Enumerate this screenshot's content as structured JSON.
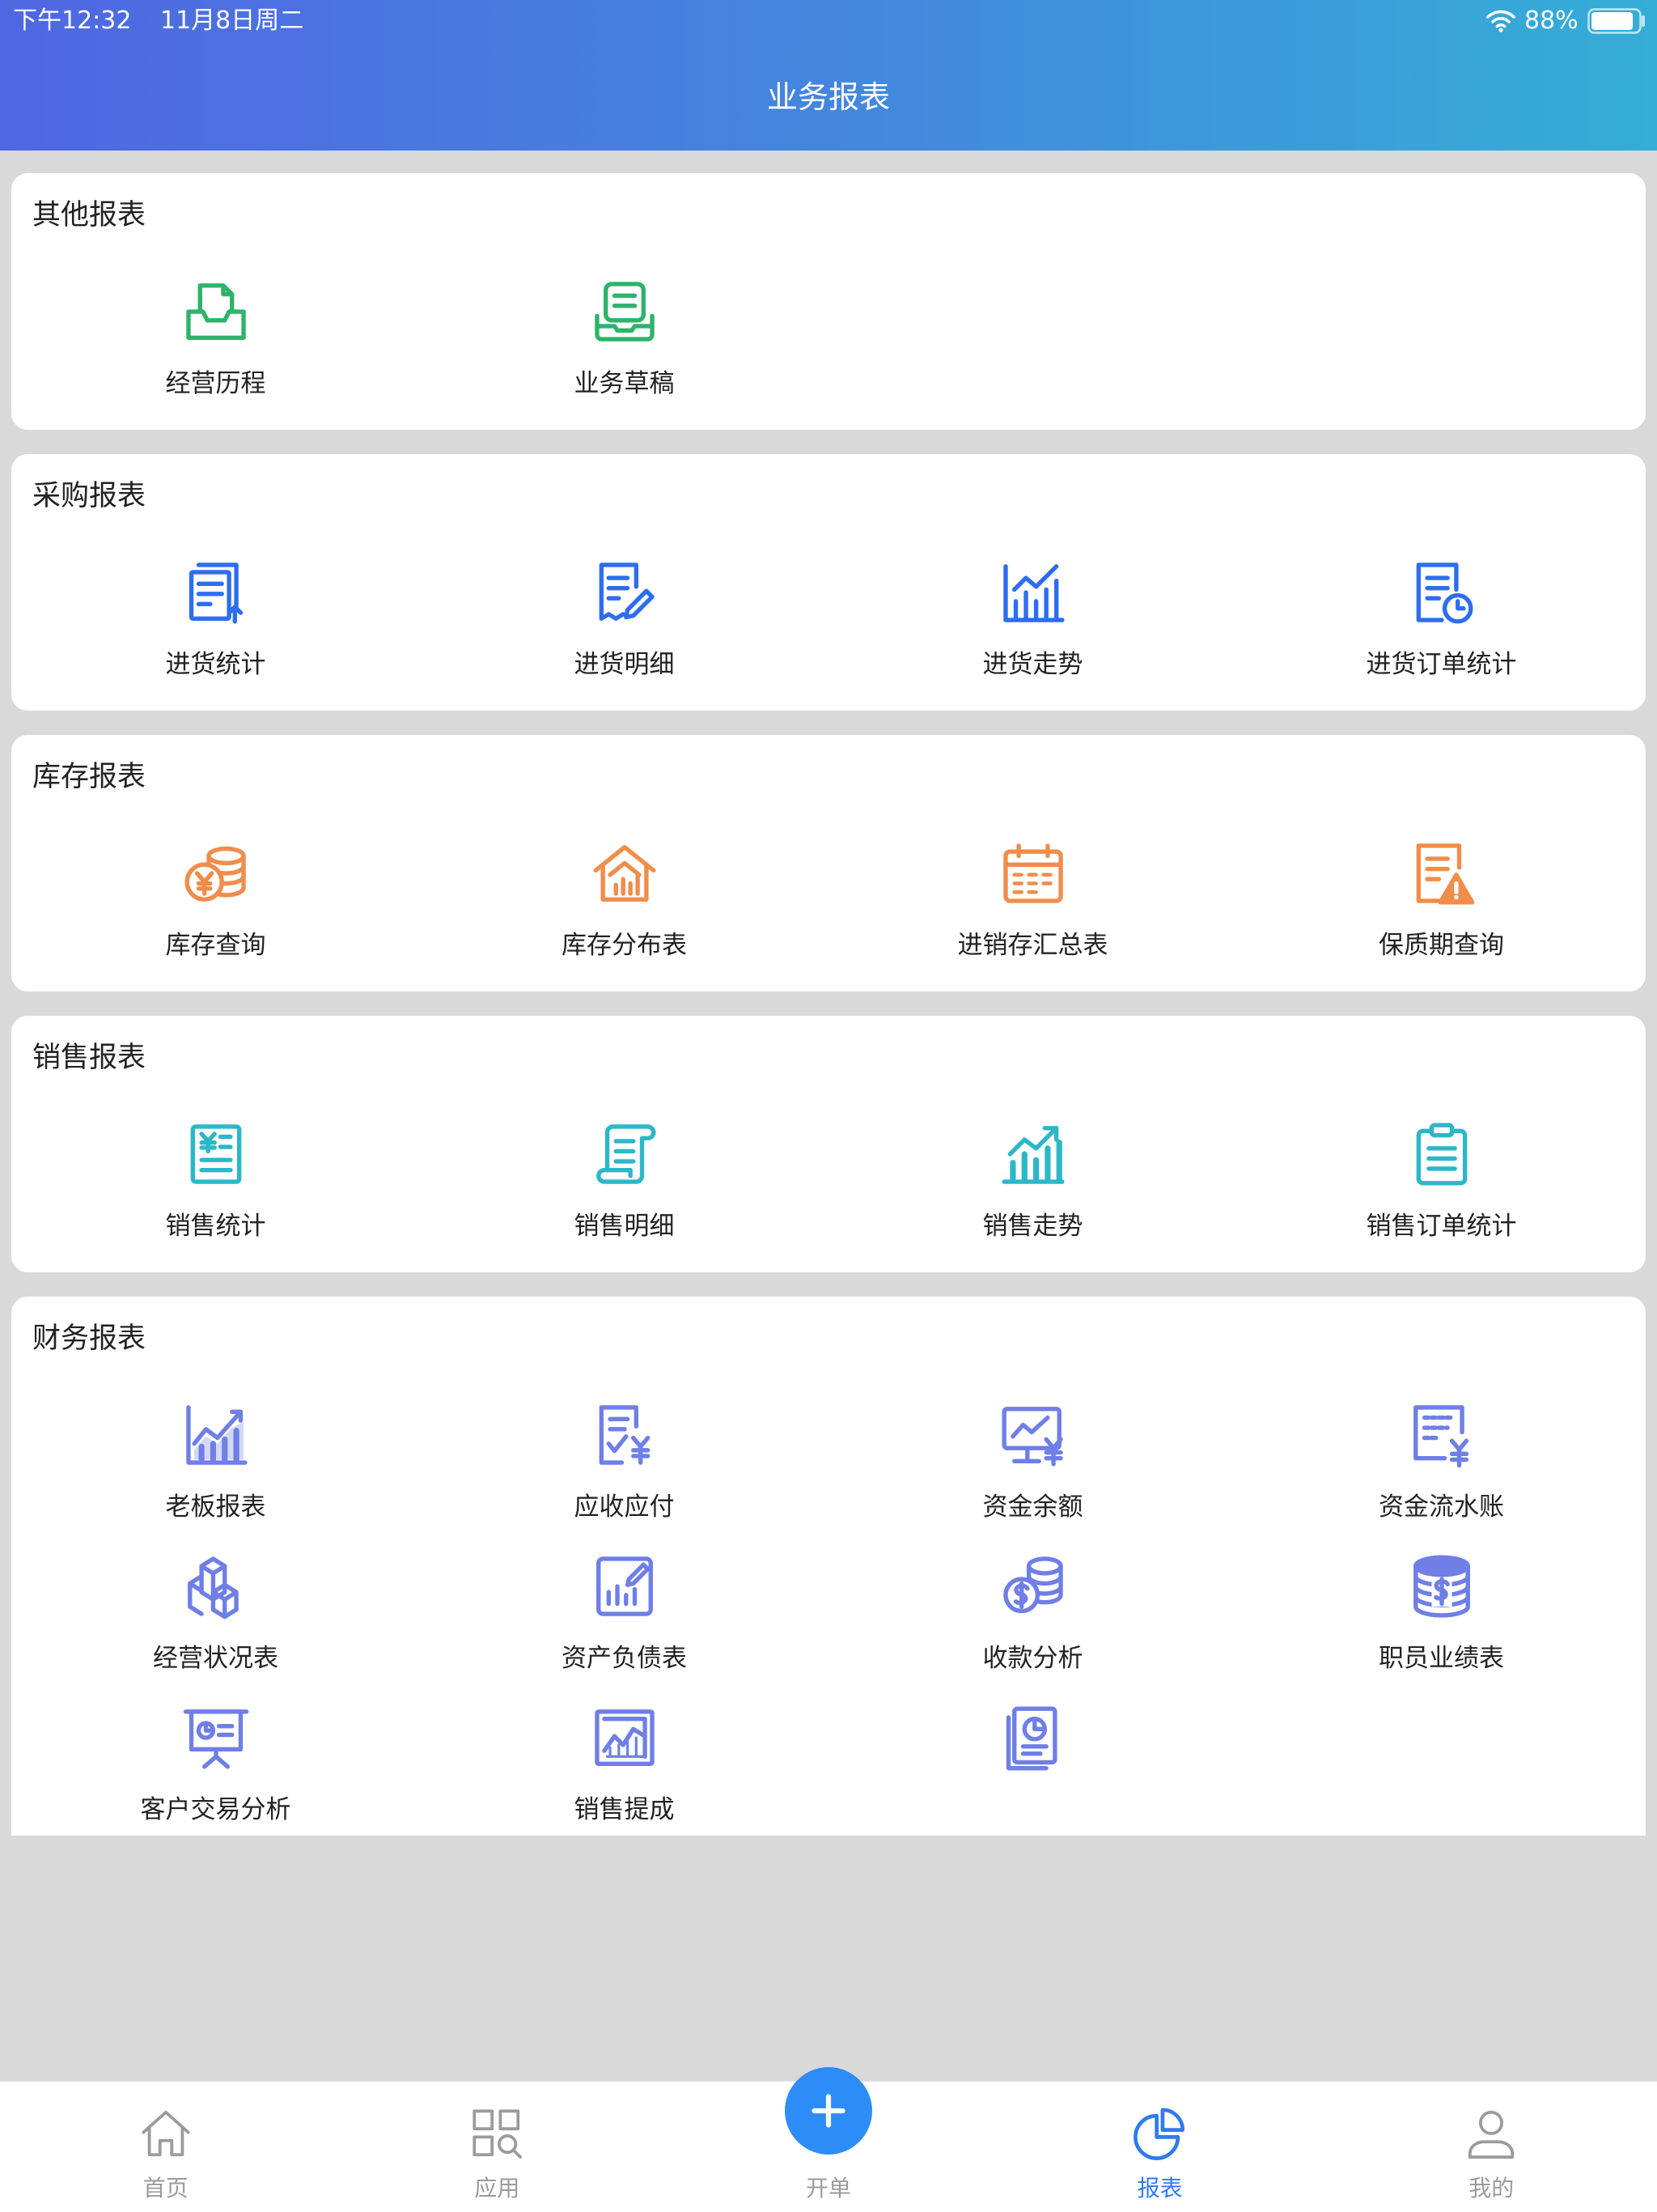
{
  "status_bar": {
    "time": "下午12:32",
    "date": "11月8日周二",
    "battery": "88%",
    "icons": [
      "wifi-icon",
      "battery-icon"
    ]
  },
  "header": {
    "title": "业务报表"
  },
  "colors": {
    "header_start": "#4f67e2",
    "header_end": "#34aed6",
    "background": "#d9d9d9",
    "other": "#2eb36b",
    "purchase": "#2d6df0",
    "inventory": "#f08d4a",
    "sales": "#2cb7c9",
    "finance": "#6f7fe6",
    "tab_active": "#2f7bef",
    "tab_inactive": "#9b9b9b",
    "plus_button": "#2d8cf7"
  },
  "sections": [
    {
      "title": "其他报表",
      "items": [
        {
          "label": "经营历程",
          "icon": "inbox-icon"
        },
        {
          "label": "业务草稿",
          "icon": "draft-icon"
        }
      ]
    },
    {
      "title": "采购报表",
      "items": [
        {
          "label": "进货统计",
          "icon": "document-stack-icon"
        },
        {
          "label": "进货明细",
          "icon": "document-edit-icon"
        },
        {
          "label": "进货走势",
          "icon": "bar-trend-icon"
        },
        {
          "label": "进货订单统计",
          "icon": "document-clock-icon"
        }
      ]
    },
    {
      "title": "库存报表",
      "items": [
        {
          "label": "库存查询",
          "icon": "coins-yen-icon"
        },
        {
          "label": "库存分布表",
          "icon": "warehouse-chart-icon"
        },
        {
          "label": "进销存汇总表",
          "icon": "calendar-icon"
        },
        {
          "label": "保质期查询",
          "icon": "document-warning-icon"
        }
      ]
    },
    {
      "title": "销售报表",
      "items": [
        {
          "label": "销售统计",
          "icon": "receipt-yen-icon"
        },
        {
          "label": "销售明细",
          "icon": "scroll-icon"
        },
        {
          "label": "销售走势",
          "icon": "bar-rising-icon"
        },
        {
          "label": "销售订单统计",
          "icon": "clipboard-icon"
        }
      ]
    },
    {
      "title": "财务报表",
      "items": [
        {
          "label": "老板报表",
          "icon": "area-chart-icon"
        },
        {
          "label": "应收应付",
          "icon": "invoice-yen-icon"
        },
        {
          "label": "资金余额",
          "icon": "monitor-yen-icon"
        },
        {
          "label": "资金流水账",
          "icon": "document-yen-icon"
        },
        {
          "label": "经营状况表",
          "icon": "building-blocks-icon"
        },
        {
          "label": "资产负债表",
          "icon": "chart-edit-icon"
        },
        {
          "label": "收款分析",
          "icon": "coins-dollar-icon"
        },
        {
          "label": "职员业绩表",
          "icon": "coin-stack-dollar-icon"
        },
        {
          "label": "客户交易分析",
          "icon": "presentation-icon"
        },
        {
          "label": "销售提成",
          "icon": "framed-chart-icon"
        },
        {
          "icon": "document-pie-icon"
        }
      ]
    }
  ],
  "tabbar": {
    "items": [
      {
        "label": "首页",
        "icon": "home-icon"
      },
      {
        "label": "应用",
        "icon": "apps-icon"
      },
      {
        "label": "开单",
        "icon": "plus-icon"
      },
      {
        "label": "报表",
        "icon": "pie-chart-icon",
        "active": true
      },
      {
        "label": "我的",
        "icon": "user-icon"
      }
    ]
  }
}
